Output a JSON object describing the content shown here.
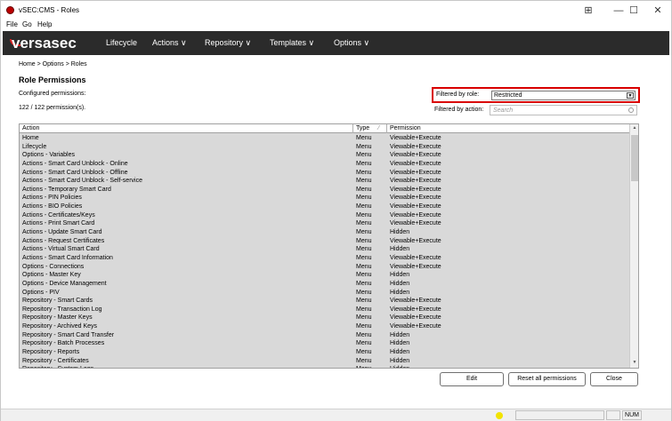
{
  "window": {
    "title": "vSEC:CMS - Roles",
    "controls": {
      "layout": "⊞",
      "minimize": "—",
      "maximize": "☐",
      "close": "✕"
    }
  },
  "menubar": [
    "File",
    "Go",
    "Help"
  ],
  "navbar": {
    "logo": "versasec",
    "items": [
      "Lifecycle",
      "Actions ∨",
      "Repository ∨",
      "Templates ∨",
      "Options ∨"
    ]
  },
  "breadcrumb": "Home > Options > Roles",
  "page_title": "Role Permissions",
  "configured_label": "Configured permissions:",
  "count_label": "122 / 122 permission(s).",
  "filter_role": {
    "label": "Filtered by role:",
    "value": "Restricted"
  },
  "filter_action": {
    "label": "Filtered by action:",
    "placeholder": "Search"
  },
  "table": {
    "headers": [
      "Action",
      "Type",
      "Permission"
    ],
    "rows": [
      [
        "Home",
        "Menu",
        "Viewable+Execute"
      ],
      [
        "Lifecycle",
        "Menu",
        "Viewable+Execute"
      ],
      [
        "Options - Variables",
        "Menu",
        "Viewable+Execute"
      ],
      [
        "Actions - Smart Card Unblock - Online",
        "Menu",
        "Viewable+Execute"
      ],
      [
        "Actions - Smart Card Unblock - Offline",
        "Menu",
        "Viewable+Execute"
      ],
      [
        "Actions - Smart Card Unblock - Self-service",
        "Menu",
        "Viewable+Execute"
      ],
      [
        "Actions - Temporary Smart Card",
        "Menu",
        "Viewable+Execute"
      ],
      [
        "Actions - PIN Policies",
        "Menu",
        "Viewable+Execute"
      ],
      [
        "Actions - BIO Policies",
        "Menu",
        "Viewable+Execute"
      ],
      [
        "Actions - Certificates/Keys",
        "Menu",
        "Viewable+Execute"
      ],
      [
        "Actions - Print Smart Card",
        "Menu",
        "Viewable+Execute"
      ],
      [
        "Actions - Update Smart Card",
        "Menu",
        "Hidden"
      ],
      [
        "Actions - Request Certificates",
        "Menu",
        "Viewable+Execute"
      ],
      [
        "Actions - Virtual Smart Card",
        "Menu",
        "Hidden"
      ],
      [
        "Actions - Smart Card Information",
        "Menu",
        "Viewable+Execute"
      ],
      [
        "Options - Connections",
        "Menu",
        "Viewable+Execute"
      ],
      [
        "Options - Master Key",
        "Menu",
        "Hidden"
      ],
      [
        "Options - Device Management",
        "Menu",
        "Hidden"
      ],
      [
        "Options - PIV",
        "Menu",
        "Hidden"
      ],
      [
        "Repository - Smart Cards",
        "Menu",
        "Viewable+Execute"
      ],
      [
        "Repository - Transaction Log",
        "Menu",
        "Viewable+Execute"
      ],
      [
        "Repository - Master Keys",
        "Menu",
        "Viewable+Execute"
      ],
      [
        "Repository - Archived Keys",
        "Menu",
        "Viewable+Execute"
      ],
      [
        "Repository - Smart Card Transfer",
        "Menu",
        "Hidden"
      ],
      [
        "Repository - Batch Processes",
        "Menu",
        "Hidden"
      ],
      [
        "Repository - Reports",
        "Menu",
        "Hidden"
      ],
      [
        "Repository - Certificates",
        "Menu",
        "Hidden"
      ],
      [
        "Repository - System Logs",
        "Menu",
        "Hidden"
      ]
    ]
  },
  "buttons": {
    "edit": "Edit",
    "reset": "Reset all permissions",
    "close": "Close"
  },
  "statusbar": {
    "num": "NUM"
  },
  "colors": {
    "navbar": "#2b2b2b",
    "highlight": "#d90000",
    "status_led": "#f2e300"
  }
}
